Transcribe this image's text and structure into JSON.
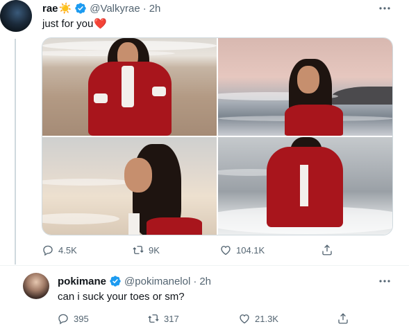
{
  "tweet": {
    "name": "rae",
    "name_emoji": "☀️",
    "handle": "@Valkyrae",
    "time": "2h",
    "text": "just for you",
    "text_emoji": "❤️",
    "actions": {
      "replies": "4.5K",
      "retweets": "9K",
      "likes": "104.1K"
    },
    "photos": [
      "woman in red jacket on beach",
      "woman in red jacket at the sea at sunset",
      "woman with eyes closed by the sea",
      "woman in red jacket standing in waves"
    ]
  },
  "reply": {
    "name": "pokimane",
    "handle": "@pokimanelol",
    "time": "2h",
    "text": "can i suck your toes or sm?",
    "actions": {
      "replies": "395",
      "retweets": "317",
      "likes": "21.3K"
    }
  },
  "ui": {
    "dot": "·",
    "icons": {
      "verified": "verified-badge-icon",
      "more": "more-horizontal-icon",
      "reply": "reply-icon",
      "retweet": "retweet-icon",
      "like": "like-icon",
      "share": "share-icon"
    },
    "colors": {
      "verified": "#1d9bf0",
      "secondary_text": "#536471",
      "heart": "#e0245e",
      "thread_line": "#cfd9de"
    }
  }
}
